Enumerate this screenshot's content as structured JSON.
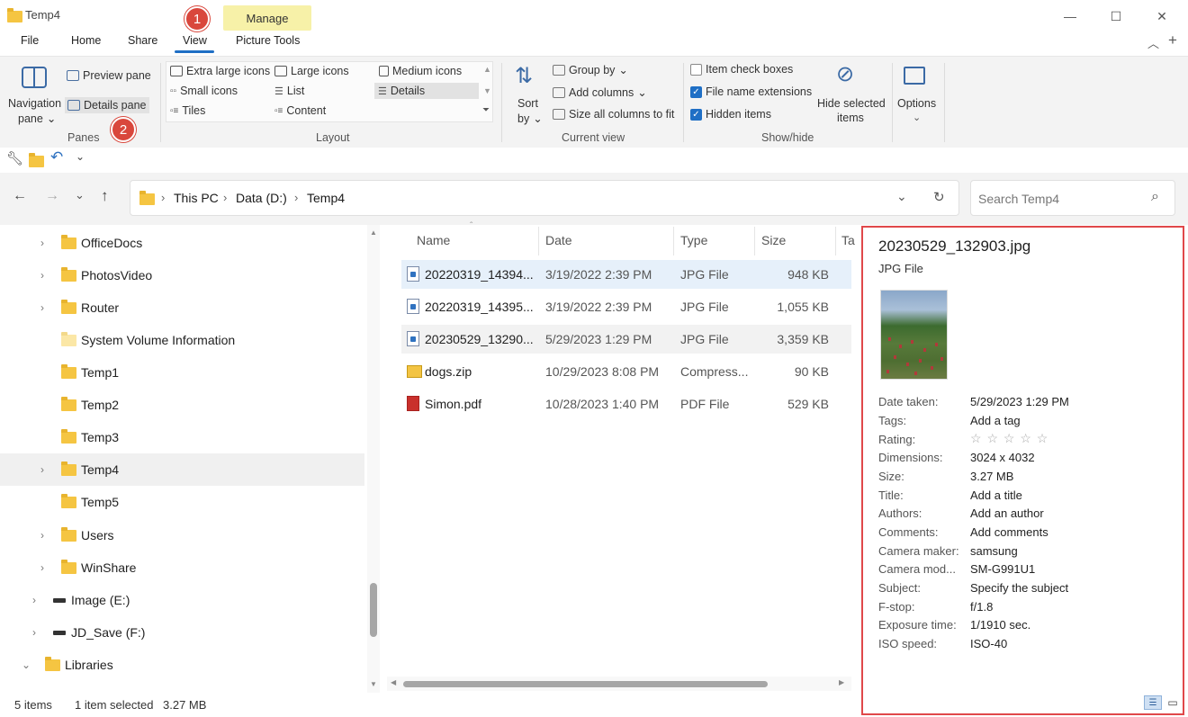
{
  "window": {
    "title": "Temp4"
  },
  "tabs": {
    "file": "File",
    "home": "Home",
    "share": "Share",
    "view": "View",
    "picture_tools": "Picture Tools",
    "manage": "Manage"
  },
  "badges": {
    "one": "1",
    "two": "2"
  },
  "ribbon": {
    "panes": {
      "navigation_pane": "Navigation",
      "navigation_pane2": "pane",
      "preview_pane": "Preview pane",
      "details_pane": "Details pane",
      "group": "Panes"
    },
    "layout": {
      "extra_large_icons": "Extra large icons",
      "large_icons": "Large icons",
      "medium_icons": "Medium icons",
      "small_icons": "Small icons",
      "list": "List",
      "details": "Details",
      "tiles": "Tiles",
      "content": "Content",
      "group": "Layout"
    },
    "current_view": {
      "sort": "Sort",
      "sort2": "by",
      "group_by": "Group by",
      "add_columns": "Add columns",
      "size_all": "Size all columns to fit",
      "group": "Current view"
    },
    "show_hide": {
      "item_check_boxes": "Item check boxes",
      "file_name_extensions": "File name extensions",
      "hidden_items": "Hidden items",
      "hide_selected": "Hide selected",
      "hide_selected2": "items",
      "group": "Show/hide"
    },
    "options": {
      "label": "Options"
    }
  },
  "address": {
    "this_pc": "This PC",
    "data_d": "Data (D:)",
    "temp4": "Temp4",
    "search_placeholder": "Search Temp4"
  },
  "nav": {
    "items": [
      {
        "label": "OfficeDocs"
      },
      {
        "label": "PhotosVideo"
      },
      {
        "label": "Router"
      },
      {
        "label": "System Volume Information"
      },
      {
        "label": "Temp1"
      },
      {
        "label": "Temp2"
      },
      {
        "label": "Temp3"
      },
      {
        "label": "Temp4"
      },
      {
        "label": "Temp5"
      },
      {
        "label": "Users"
      },
      {
        "label": "WinShare"
      },
      {
        "label": "Image (E:)"
      },
      {
        "label": "JD_Save (F:)"
      },
      {
        "label": "Libraries"
      }
    ]
  },
  "columns": {
    "name": "Name",
    "date": "Date",
    "type": "Type",
    "size": "Size",
    "tags": "Ta"
  },
  "files": [
    {
      "name": "20220319_14394...",
      "date": "3/19/2022 2:39 PM",
      "type": "JPG File",
      "size": "948 KB"
    },
    {
      "name": "20220319_14395...",
      "date": "3/19/2022 2:39 PM",
      "type": "JPG File",
      "size": "1,055 KB"
    },
    {
      "name": "20230529_13290...",
      "date": "5/29/2023 1:29 PM",
      "type": "JPG File",
      "size": "3,359 KB"
    },
    {
      "name": "dogs.zip",
      "date": "10/29/2023 8:08 PM",
      "type": "Compress...",
      "size": "90 KB"
    },
    {
      "name": "Simon.pdf",
      "date": "10/28/2023 1:40 PM",
      "type": "PDF File",
      "size": "529 KB"
    }
  ],
  "details": {
    "filename": "20230529_132903.jpg",
    "filetype": "JPG File",
    "rating_stars": "☆ ☆ ☆ ☆ ☆",
    "props": [
      {
        "label": "Date taken:",
        "value": "5/29/2023 1:29 PM"
      },
      {
        "label": "Tags:",
        "value": "Add a tag"
      },
      {
        "label": "Rating:",
        "value": ""
      },
      {
        "label": "Dimensions:",
        "value": "3024 x 4032"
      },
      {
        "label": "Size:",
        "value": "3.27 MB"
      },
      {
        "label": "Title:",
        "value": "Add a title"
      },
      {
        "label": "Authors:",
        "value": "Add an author"
      },
      {
        "label": "Comments:",
        "value": "Add comments"
      },
      {
        "label": "Camera maker:",
        "value": "samsung"
      },
      {
        "label": "Camera mod...",
        "value": "SM-G991U1"
      },
      {
        "label": "Subject:",
        "value": "Specify the subject"
      },
      {
        "label": "F-stop:",
        "value": "f/1.8"
      },
      {
        "label": "Exposure time:",
        "value": "1/1910 sec."
      },
      {
        "label": "ISO speed:",
        "value": "ISO-40"
      }
    ]
  },
  "status": {
    "items": "5 items",
    "selected": "1 item selected",
    "size": "3.27 MB"
  },
  "colors": {
    "highlight_border": "#e0484a",
    "manage_tab": "#f7f1a8",
    "badge": "#d9473c",
    "accent": "#1f6fc5"
  }
}
